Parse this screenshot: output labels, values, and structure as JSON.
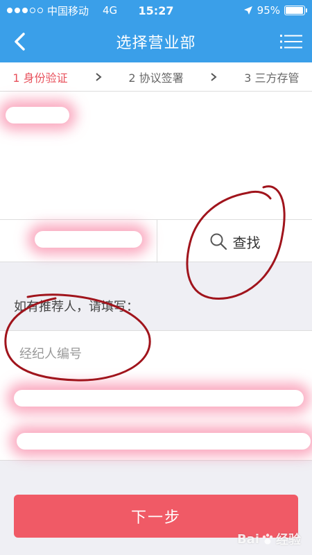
{
  "status_bar": {
    "carrier": "中国移动",
    "network": "4G",
    "time": "15:27",
    "battery": "95%",
    "battery_level": 0.95
  },
  "nav": {
    "title": "选择营业部",
    "back_icon": "chevron-left-icon",
    "menu_icon": "list-menu-icon"
  },
  "steps": [
    {
      "label": "1 身份验证",
      "active": true
    },
    {
      "label": "2 协议签署",
      "active": false
    },
    {
      "label": "3 三方存管",
      "active": false
    }
  ],
  "search": {
    "button_label": "查找",
    "icon": "search-icon"
  },
  "referrer": {
    "label": "如有推荐人，请填写：",
    "placeholder": "经纪人编号"
  },
  "next_button": {
    "label": "下一步"
  },
  "watermark": {
    "text": "Bai",
    "suffix": "经验"
  },
  "colors": {
    "header_bg": "#3a9fe9",
    "accent_red": "#f05a66",
    "active_step": "#e8515c"
  }
}
